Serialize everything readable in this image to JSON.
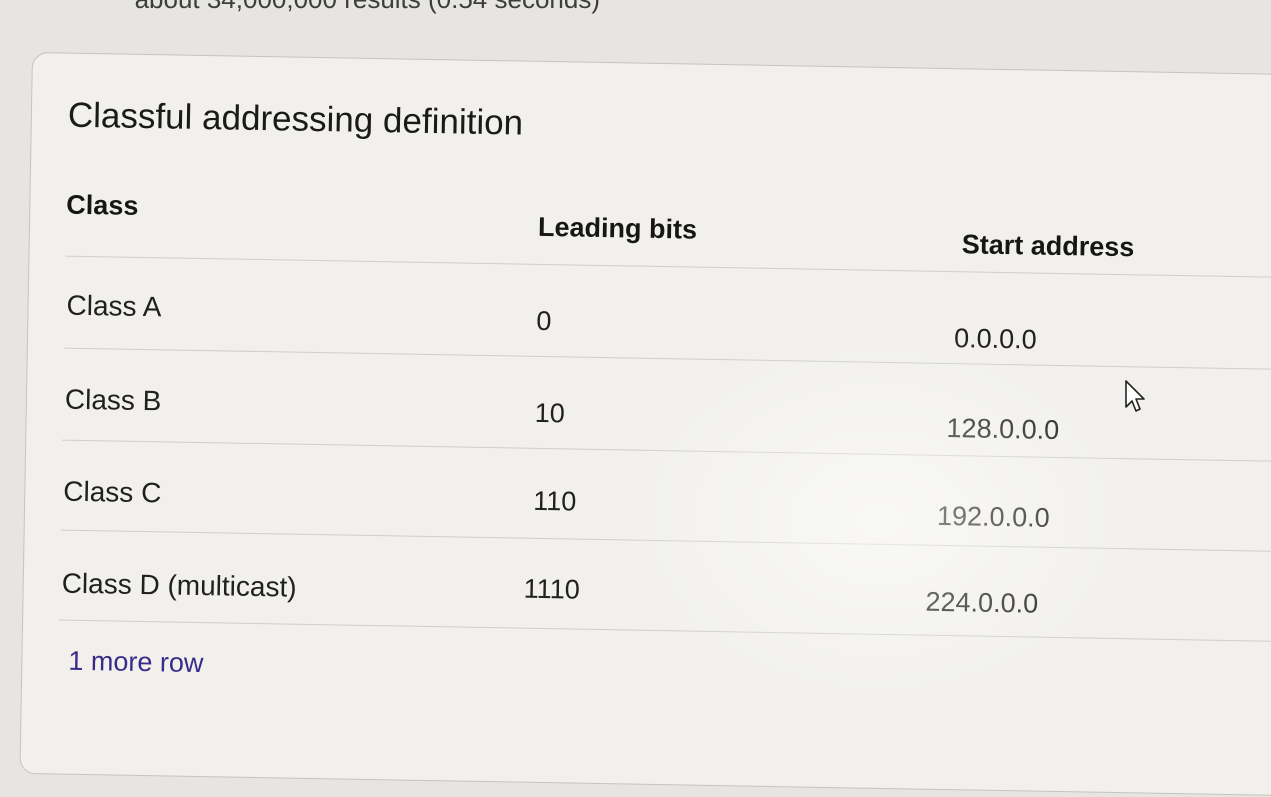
{
  "search": {
    "results_stats": "about 34,000,000 results (0.54 seconds)"
  },
  "snippet": {
    "title": "Classful addressing definition",
    "columns": [
      "Class",
      "Leading bits",
      "Start address"
    ],
    "rows": [
      [
        "Class A",
        "0",
        "0.0.0.0"
      ],
      [
        "Class B",
        "10",
        "128.0.0.0"
      ],
      [
        "Class C",
        "110",
        "192.0.0.0"
      ],
      [
        "Class D (multicast)",
        "1110",
        "224.0.0.0"
      ]
    ],
    "more_rows_label": "1 more row"
  },
  "icons": {
    "cursor": "mouse-pointer-icon"
  }
}
